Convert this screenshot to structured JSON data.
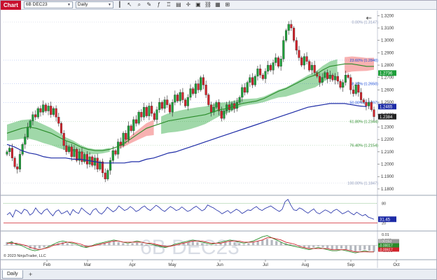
{
  "toolbar": {
    "chart_label": "Chart",
    "instrument": "6B DEC23",
    "interval": "Daily"
  },
  "watermark": "6B DEC23",
  "copyright": "© 2023 NinjaTrader, LLC",
  "tabs": [
    {
      "label": "Daily"
    }
  ],
  "tab_add": "+",
  "colors": {
    "up": "#1e9e3a",
    "down": "#d0232b",
    "cloud_bull": "#8fd19a",
    "cloud_bear": "#f7a3a3",
    "sma": "#2a8c2a",
    "ema": "#1d2ba6",
    "fib": "#1f4fd8"
  },
  "chart_data": [
    {
      "type": "candlestick",
      "x_labels": [
        "Feb",
        "Mar",
        "Apr",
        "May",
        "Jun",
        "Jul",
        "Aug",
        "Sep",
        "Oct"
      ],
      "y_ticks": [
        "1.3200",
        "1.3100",
        "1.3000",
        "1.2900",
        "1.2800",
        "1.2700",
        "1.2600",
        "1.2500",
        "1.2400",
        "1.2300",
        "1.2200",
        "1.2100",
        "1.2000",
        "1.1900",
        "1.1800"
      ],
      "ylim": [
        1.176,
        1.323
      ],
      "fib_levels": [
        {
          "label": "0.00% (1.3147)",
          "value": 1.3147,
          "color": "#8a96b8"
        },
        {
          "label": "23.60% (1.2840)",
          "value": 1.284,
          "color": "#1f4fd8"
        },
        {
          "label": "38.20% (1.2650)",
          "value": 1.265,
          "color": "#1f4fd8"
        },
        {
          "label": "50.00% (1.2497)",
          "value": 1.2497,
          "color": "#1f4fd8"
        },
        {
          "label": "61.80% (1.2344)",
          "value": 1.2344,
          "color": "#2a8c2a"
        },
        {
          "label": "76.40% (1.2154)",
          "value": 1.2154,
          "color": "#2a8c2a"
        },
        {
          "label": "100.00% (1.1847)",
          "value": 1.1847,
          "color": "#8a96b8"
        }
      ],
      "price_tags": [
        {
          "label": "1.2736",
          "value": 1.2736,
          "color": "#1e9e3a"
        },
        {
          "label": "1.2465",
          "value": 1.2465,
          "color": "#1d2ba6"
        },
        {
          "label": "1.2384",
          "value": 1.2384,
          "color": "#222222"
        }
      ],
      "closes": [
        1.21,
        1.213,
        1.205,
        1.198,
        1.196,
        1.208,
        1.216,
        1.222,
        1.23,
        1.235,
        1.24,
        1.238,
        1.245,
        1.242,
        1.248,
        1.243,
        1.247,
        1.24,
        1.245,
        1.238,
        1.233,
        1.225,
        1.215,
        1.21,
        1.214,
        1.206,
        1.212,
        1.203,
        1.21,
        1.202,
        1.208,
        1.2,
        1.206,
        1.199,
        1.205,
        1.196,
        1.202,
        1.193,
        1.188,
        1.195,
        1.203,
        1.211,
        1.208,
        1.218,
        1.215,
        1.225,
        1.22,
        1.231,
        1.227,
        1.236,
        1.233,
        1.242,
        1.238,
        1.246,
        1.239,
        1.247,
        1.241,
        1.236,
        1.244,
        1.25,
        1.245,
        1.252,
        1.248,
        1.242,
        1.25,
        1.256,
        1.251,
        1.258,
        1.252,
        1.247,
        1.254,
        1.261,
        1.257,
        1.265,
        1.26,
        1.27,
        1.264,
        1.256,
        1.248,
        1.242,
        1.246,
        1.25,
        1.243,
        1.237,
        1.243,
        1.248,
        1.244,
        1.249,
        1.245,
        1.25,
        1.254,
        1.262,
        1.258,
        1.266,
        1.27,
        1.264,
        1.271,
        1.277,
        1.272,
        1.269,
        1.275,
        1.28,
        1.276,
        1.282,
        1.286,
        1.279,
        1.285,
        1.3,
        1.308,
        1.313,
        1.31,
        1.3,
        1.292,
        1.286,
        1.28,
        1.287,
        1.283,
        1.276,
        1.28,
        1.274,
        1.271,
        1.266,
        1.27,
        1.274,
        1.269,
        1.272,
        1.268,
        1.271,
        1.267,
        1.262,
        1.266,
        1.272,
        1.27,
        1.26,
        1.257,
        1.264,
        1.258,
        1.252,
        1.25,
        1.247,
        1.25,
        1.244,
        1.2384
      ],
      "sma": [
        1.225,
        1.227,
        1.229,
        1.23,
        1.229,
        1.227,
        1.225,
        1.222,
        1.219,
        1.217,
        1.214,
        1.212,
        1.211,
        1.211,
        1.212,
        1.214,
        1.217,
        1.221,
        1.225,
        1.229,
        1.231,
        1.233,
        1.235,
        1.236,
        1.237,
        1.238,
        1.239,
        1.24,
        1.242,
        1.244,
        1.245,
        1.247,
        1.249,
        1.25,
        1.251,
        1.253,
        1.256,
        1.259,
        1.261,
        1.264,
        1.267,
        1.27,
        1.272,
        1.276,
        1.279,
        1.28,
        1.281,
        1.281,
        1.28,
        1.279,
        1.279
      ],
      "ema": [
        1.216,
        1.214,
        1.211,
        1.209,
        1.208,
        1.206,
        1.205,
        1.205,
        1.205,
        1.204,
        1.204,
        1.203,
        1.202,
        1.201,
        1.201,
        1.201,
        1.201,
        1.202,
        1.202,
        1.204,
        1.205,
        1.207,
        1.209,
        1.21,
        1.212,
        1.214,
        1.216,
        1.218,
        1.22,
        1.222,
        1.224,
        1.226,
        1.228,
        1.23,
        1.232,
        1.234,
        1.236,
        1.238,
        1.24,
        1.242,
        1.244,
        1.246,
        1.247,
        1.248,
        1.249,
        1.249,
        1.249,
        1.248,
        1.247,
        1.2465
      ]
    },
    {
      "type": "line",
      "name": "",
      "y_labels": [
        "80",
        "20"
      ],
      "y_ticks": [
        80,
        20
      ],
      "ylim": [
        0,
        100
      ],
      "current_label": "31.45",
      "values": [
        45,
        52,
        38,
        60,
        55,
        48,
        62,
        58,
        44,
        50,
        66,
        54,
        47,
        58,
        63,
        51,
        42,
        55,
        60,
        48,
        52,
        57,
        44,
        61,
        53,
        49,
        66,
        58,
        51,
        45,
        59,
        64,
        52,
        47,
        56,
        68,
        61,
        54,
        60,
        72,
        65,
        58,
        62,
        70,
        64,
        55,
        59,
        67,
        72,
        63,
        58,
        66,
        74,
        68,
        60,
        55,
        63,
        70,
        65,
        58,
        61,
        69,
        62,
        55,
        59,
        66,
        71,
        64,
        57,
        62,
        75,
        70,
        66,
        60,
        55,
        48,
        53,
        58,
        50,
        56,
        62,
        57,
        49,
        54,
        60,
        58,
        65,
        70,
        62,
        58,
        64,
        68,
        72,
        66,
        60,
        55,
        62,
        85,
        92,
        74,
        60,
        58,
        66,
        62,
        55,
        50,
        57,
        63,
        52,
        48,
        54,
        60,
        56,
        50,
        58,
        62,
        55,
        48,
        52,
        57,
        50,
        45,
        53,
        47,
        42,
        46,
        38,
        35,
        31.45
      ]
    },
    {
      "type": "bar",
      "name": "",
      "y_labels": [
        "0.01",
        "0.005",
        "0",
        "-0.005"
      ],
      "y_ticks": [
        0.01,
        0.005,
        0,
        -0.005
      ],
      "ylim": [
        -0.012,
        0.012
      ],
      "tag_labels": [
        "0.00153",
        "-0.00017",
        "-0.00617"
      ],
      "values": [
        0.003,
        0.004,
        0.002,
        0.001,
        -0.001,
        -0.003,
        -0.004,
        -0.003,
        -0.002,
        -0.001,
        0.001,
        0.002,
        0.003,
        0.002,
        0.001,
        0.0,
        -0.001,
        -0.002,
        -0.001,
        0.0,
        0.001,
        0.002,
        0.003,
        0.004,
        0.003,
        0.002,
        0.001,
        0.002,
        0.003,
        0.002,
        0.001,
        0.0,
        -0.001,
        -0.002,
        -0.002,
        -0.001,
        0.0,
        0.001,
        0.002,
        0.003,
        0.004,
        0.003,
        0.002,
        0.001,
        0.0,
        0.001,
        0.002,
        0.003,
        0.004,
        0.003,
        0.002,
        0.001,
        0.002,
        0.003,
        0.004,
        0.005,
        0.006,
        0.005,
        0.004,
        0.003,
        0.002,
        0.001,
        0.0,
        -0.001,
        -0.002,
        -0.003,
        -0.002,
        -0.001,
        -0.002,
        -0.003,
        -0.004,
        -0.004,
        -0.003,
        -0.004,
        -0.005,
        -0.006,
        -0.005,
        -0.004,
        -0.005,
        -0.006
      ],
      "macd": [
        0.002,
        0.003,
        0.001,
        0.0,
        -0.002,
        -0.004,
        -0.005,
        -0.004,
        -0.003,
        -0.001,
        0.001,
        0.003,
        0.004,
        0.003,
        0.002,
        0.001,
        -0.001,
        -0.002,
        -0.001,
        0.001,
        0.002,
        0.003,
        0.004,
        0.005,
        0.004,
        0.003,
        0.002,
        0.003,
        0.004,
        0.003,
        0.002,
        0.001,
        0.0,
        -0.001,
        -0.002,
        -0.001,
        0.001,
        0.002,
        0.003,
        0.004,
        0.005,
        0.004,
        0.003,
        0.002,
        0.001,
        0.002,
        0.003,
        0.004,
        0.005,
        0.004,
        0.003,
        0.002,
        0.003,
        0.004,
        0.006,
        0.008,
        0.009,
        0.007,
        0.005,
        0.003,
        0.001,
        0.0,
        -0.001,
        -0.002,
        -0.003,
        -0.004,
        -0.003,
        -0.002,
        -0.003,
        -0.004,
        -0.005,
        -0.005,
        -0.004,
        -0.005,
        -0.006,
        -0.007,
        -0.006,
        -0.005,
        -0.006,
        -0.006
      ],
      "signal": [
        0.002,
        0.002,
        0.002,
        0.001,
        0.0,
        -0.002,
        -0.003,
        -0.004,
        -0.003,
        -0.002,
        0.0,
        0.001,
        0.002,
        0.003,
        0.003,
        0.002,
        0.001,
        -0.001,
        -0.001,
        0.0,
        0.001,
        0.002,
        0.003,
        0.004,
        0.004,
        0.003,
        0.003,
        0.003,
        0.003,
        0.003,
        0.002,
        0.002,
        0.001,
        0.0,
        -0.001,
        -0.001,
        0.0,
        0.001,
        0.002,
        0.003,
        0.004,
        0.004,
        0.004,
        0.003,
        0.002,
        0.002,
        0.002,
        0.003,
        0.004,
        0.004,
        0.004,
        0.003,
        0.003,
        0.003,
        0.004,
        0.005,
        0.007,
        0.007,
        0.006,
        0.005,
        0.003,
        0.002,
        0.001,
        -0.001,
        -0.002,
        -0.003,
        -0.003,
        -0.003,
        -0.003,
        -0.003,
        -0.004,
        -0.004,
        -0.004,
        -0.004,
        -0.005,
        -0.006,
        -0.006,
        -0.006,
        -0.006,
        -0.006
      ]
    }
  ]
}
